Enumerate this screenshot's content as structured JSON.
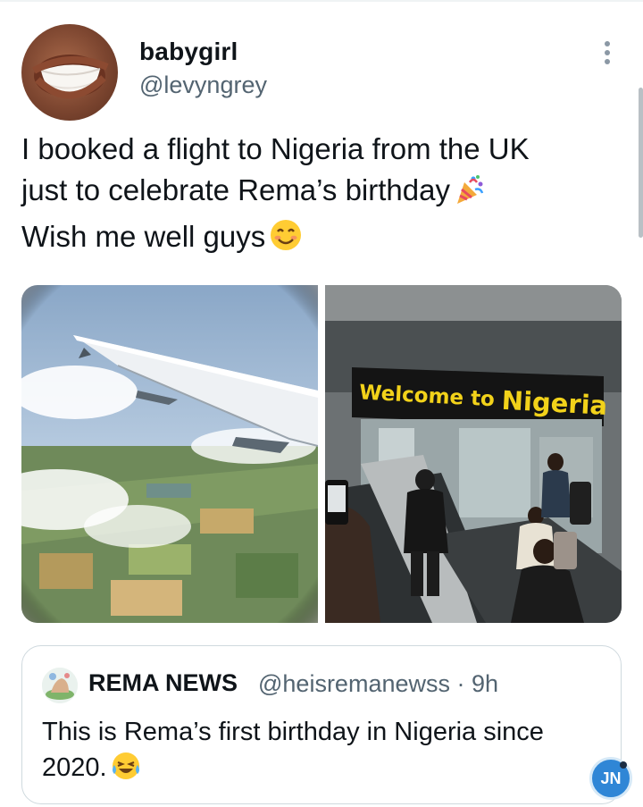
{
  "tweet": {
    "author": {
      "display_name": "babygirl",
      "handle": "@levyngrey"
    },
    "text_lines": [
      "I booked a flight to Nigeria from the UK",
      "just to celebrate Rema’s birthday",
      "Wish me well guys"
    ],
    "emojis": [
      "party-popper",
      "smiling-face"
    ],
    "media": [
      {
        "kind": "photo",
        "subject": "airplane-wing-view"
      },
      {
        "kind": "photo",
        "subject": "airport-escalator",
        "sign_text_a": "Welcome to",
        "sign_text_b": "Nigeria"
      }
    ]
  },
  "quoted_tweet": {
    "display_name": "REMA NEWS",
    "handle": "@heisremanewss",
    "separator": "·",
    "age": "9h",
    "text_lines": [
      "This is Rema’s first birthday in Nigeria since",
      "2020."
    ],
    "emoji": "tears-of-joy"
  },
  "watermark": {
    "label": "JN"
  },
  "colors": {
    "text": "#0f1419",
    "secondary": "#536471",
    "border": "#cfd9de",
    "sign_yellow": "#f2d21a",
    "badge": "#2f86d6"
  }
}
